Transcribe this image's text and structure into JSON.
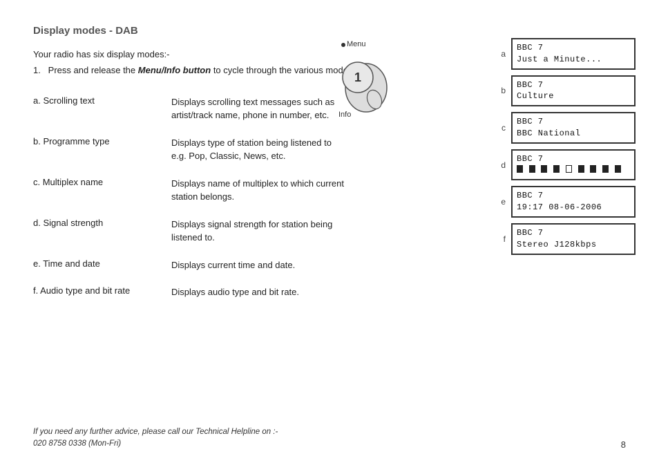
{
  "page": {
    "title": "Display modes - DAB",
    "intro": "Your radio has six display modes:-",
    "step1": "Press and release the ",
    "step1_bold": "Menu/Info button",
    "step1_rest": " to cycle through the various modes.",
    "modes": [
      {
        "label": "a. Scrolling text",
        "desc": "Displays scrolling text messages such as artist/track name, phone in number, etc."
      },
      {
        "label": "b. Programme type",
        "desc": "Displays type of station being listened to e.g. Pop, Classic, News, etc."
      },
      {
        "label": "c. Multiplex name",
        "desc": "Displays name of multiplex to which current  station belongs."
      },
      {
        "label": "d. Signal strength",
        "desc": "Displays signal strength for station being listened to."
      },
      {
        "label": "e. Time and date",
        "desc": "Displays current time and date."
      },
      {
        "label": "f. Audio type and bit rate",
        "desc": "Displays audio type and bit rate."
      }
    ],
    "screens": [
      {
        "letter": "a",
        "line1": "BBC 7",
        "line2": "Just a Minute..."
      },
      {
        "letter": "b",
        "line1": "BBC 7",
        "line2": "Culture"
      },
      {
        "letter": "c",
        "line1": "BBC 7",
        "line2": "BBC National"
      },
      {
        "letter": "d",
        "line1": "BBC 7",
        "line2": "signal"
      },
      {
        "letter": "e",
        "line1": "BBC 7",
        "line2": "19:17 08-06-2006"
      },
      {
        "letter": "f",
        "line1": "BBC 7",
        "line2": "Stereo J128kbps"
      }
    ],
    "illustration": {
      "menu_label": "Menu",
      "info_label": "Info",
      "number": "1"
    },
    "footer": {
      "line1": "If you need any further advice, please call our Technical Helpline on :-",
      "line2": "020 8758 0338 (Mon-Fri)"
    },
    "page_number": "8"
  }
}
